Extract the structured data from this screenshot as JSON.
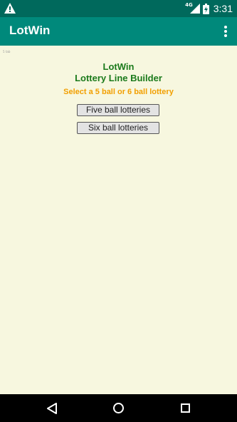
{
  "status_bar": {
    "network": "4G",
    "time": "3:31"
  },
  "app_bar": {
    "title": "LotWin"
  },
  "content": {
    "tiny_tag": "5 tab",
    "heading_line1": "LotWin",
    "heading_line2": "Lottery Line Builder",
    "subtitle": "Select a 5 ball or 6 ball lottery",
    "buttons": {
      "five": "Five ball lotteries",
      "six": "Six ball lotteries"
    }
  },
  "colors": {
    "status_bar": "#00695c",
    "app_bar": "#00897b",
    "background": "#f7f7df",
    "heading": "#1b7a1b",
    "subtitle": "#f29f00"
  }
}
